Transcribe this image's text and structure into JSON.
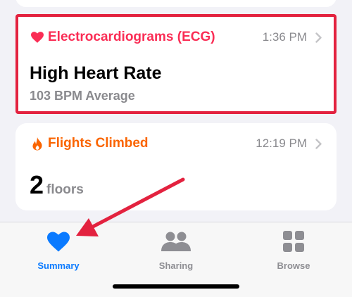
{
  "ecg_card": {
    "category": "Electrocardiograms (ECG)",
    "time": "1:36 PM",
    "value": "High Heart Rate",
    "subtitle": "103 BPM Average",
    "icon": "heart-icon",
    "color": "#fa2d55",
    "highlight_color": "#e3223f"
  },
  "flights_card": {
    "category": "Flights Climbed",
    "time": "12:19 PM",
    "value": "2",
    "unit": "floors",
    "icon": "flame-icon",
    "color": "#fa6400"
  },
  "tabbar": {
    "tabs": [
      {
        "label": "Summary",
        "icon": "heart-icon",
        "selected": true,
        "color": "#0a7aff"
      },
      {
        "label": "Sharing",
        "icon": "people-icon",
        "selected": false,
        "color": "#8e8e93"
      },
      {
        "label": "Browse",
        "icon": "grid-icon",
        "selected": false,
        "color": "#8e8e93"
      }
    ]
  },
  "annotation": {
    "icon": "red-arrow-icon",
    "color": "#e3223f"
  }
}
